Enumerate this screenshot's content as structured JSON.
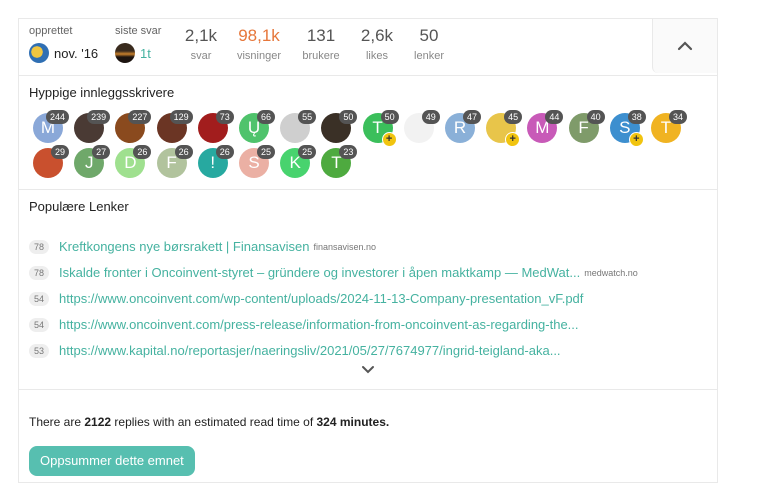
{
  "stats": {
    "created_label": "opprettet",
    "created_value": "nov. '16",
    "last_reply_label": "siste svar",
    "last_reply_value": "1t",
    "replies": {
      "num": "2,1k",
      "label": "svar"
    },
    "views": {
      "num": "98,1k",
      "label": "visninger"
    },
    "users": {
      "num": "131",
      "label": "brukere"
    },
    "likes": {
      "num": "2,6k",
      "label": "likes"
    },
    "links": {
      "num": "50",
      "label": "lenker"
    }
  },
  "posters": {
    "title": "Hyppige innleggsskrivere",
    "row1": [
      {
        "letter": "M",
        "count": "244",
        "color": "#8aa8d8",
        "plus": false
      },
      {
        "letter": "",
        "count": "239",
        "color": "#4a3a34",
        "plus": false
      },
      {
        "letter": "",
        "count": "227",
        "color": "#8a4a1e",
        "plus": false
      },
      {
        "letter": "",
        "count": "129",
        "color": "#6b3524",
        "plus": false
      },
      {
        "letter": "",
        "count": "73",
        "color": "#a21d1d",
        "plus": false
      },
      {
        "letter": "Ų",
        "count": "66",
        "color": "#4fc36c",
        "plus": false
      },
      {
        "letter": "",
        "count": "55",
        "color": "#cfcfcf",
        "plus": false
      },
      {
        "letter": "",
        "count": "50",
        "color": "#3a3026",
        "plus": false
      },
      {
        "letter": "T",
        "count": "50",
        "color": "#3bbf5b",
        "plus": true
      },
      {
        "letter": "",
        "count": "49",
        "color": "#f2f2f2",
        "plus": false
      },
      {
        "letter": "R",
        "count": "47",
        "color": "#8ab0d8",
        "plus": false
      },
      {
        "letter": "",
        "count": "45",
        "color": "#e8c54a",
        "plus": true
      },
      {
        "letter": "M",
        "count": "44",
        "color": "#c85ab8",
        "plus": false
      },
      {
        "letter": "F",
        "count": "40",
        "color": "#7f9b6a",
        "plus": false
      },
      {
        "letter": "S",
        "count": "38",
        "color": "#3d8fcf",
        "plus": true
      },
      {
        "letter": "T",
        "count": "34",
        "color": "#f0b322",
        "plus": false
      }
    ],
    "row2": [
      {
        "letter": "",
        "count": "29",
        "color": "#c9502e",
        "plus": false
      },
      {
        "letter": "J",
        "count": "27",
        "color": "#6fa86a",
        "plus": false
      },
      {
        "letter": "D",
        "count": "26",
        "color": "#9fe08f",
        "plus": false
      },
      {
        "letter": "F",
        "count": "26",
        "color": "#b1c39d",
        "plus": false
      },
      {
        "letter": "!",
        "count": "26",
        "color": "#27a9a0",
        "plus": false
      },
      {
        "letter": "S",
        "count": "25",
        "color": "#ebb0a4",
        "plus": false
      },
      {
        "letter": "K",
        "count": "25",
        "color": "#48d36e",
        "plus": false
      },
      {
        "letter": "T",
        "count": "23",
        "color": "#4eaa3f",
        "plus": false
      }
    ]
  },
  "links": {
    "title": "Populære Lenker",
    "items": [
      {
        "count": "78",
        "text": "Kreftkongens nye børsrakett | Finansavisen",
        "domain": "finansavisen.no"
      },
      {
        "count": "78",
        "text": "Iskalde fronter i Oncoinvent-styret – gründere og investorer i åpen maktkamp — MedWat...",
        "domain": "medwatch.no"
      },
      {
        "count": "54",
        "text": "https://www.oncoinvent.com/wp-content/uploads/2024-11-13-Company-presentation_vF.pdf",
        "domain": ""
      },
      {
        "count": "54",
        "text": "https://www.oncoinvent.com/press-release/information-from-oncoinvent-as-regarding-the...",
        "domain": ""
      },
      {
        "count": "53",
        "text": "https://www.kapital.no/reportasjer/naeringsliv/2021/05/27/7674977/ingrid-teigland-aka...",
        "domain": ""
      }
    ]
  },
  "summary": {
    "prefix": "There are ",
    "replies": "2122",
    "middle": " replies with an estimated read time of ",
    "minutes": "324 minutes.",
    "button": "Oppsummer dette emnet"
  },
  "icons": {
    "collapse": "chevron-up-icon",
    "expand": "chevron-down-icon",
    "plus": "plus-icon"
  },
  "colors": {
    "accent": "#45b2a0",
    "button": "#57bfb0",
    "views": "#e6773b"
  }
}
